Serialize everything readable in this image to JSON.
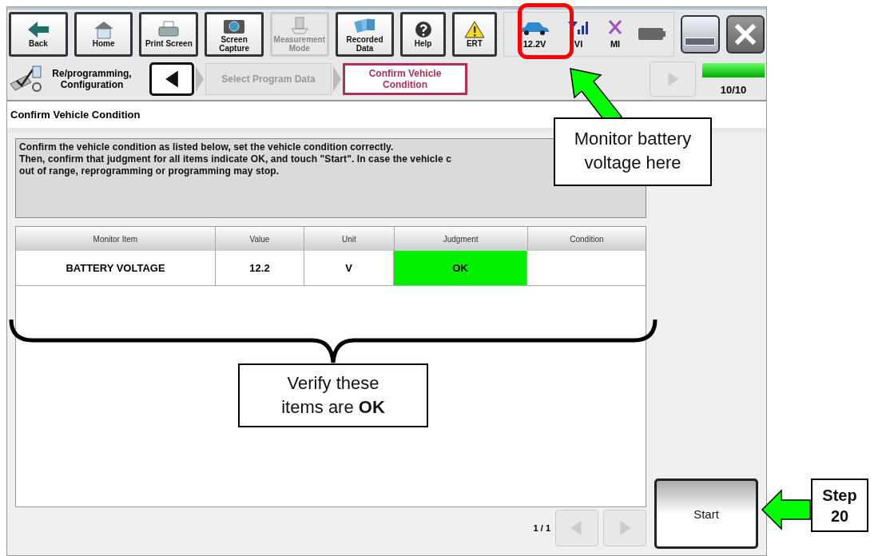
{
  "toolbar": {
    "buttons": [
      {
        "label": "Back",
        "kind": "back",
        "disabled": false
      },
      {
        "label": "Home",
        "kind": "home",
        "disabled": false
      },
      {
        "label": "Print Screen",
        "kind": "print",
        "disabled": false
      },
      {
        "label": "Screen Capture",
        "kind": "capture",
        "disabled": false
      },
      {
        "label": "Measurement Mode",
        "kind": "measurement",
        "disabled": true
      },
      {
        "label": "Recorded Data",
        "kind": "recorded",
        "disabled": false
      },
      {
        "label": "Help",
        "kind": "help",
        "disabled": false
      },
      {
        "label": "ERT",
        "kind": "ert",
        "disabled": false
      }
    ],
    "status": [
      {
        "label": "12.2V",
        "kind": "car"
      },
      {
        "label": "VI",
        "kind": "signal"
      },
      {
        "label": "MI",
        "kind": "cross"
      },
      {
        "kind": "battery"
      }
    ]
  },
  "breadcrumb": {
    "app_label": "Re/programming, Configuration",
    "steps": [
      {
        "label": "Select Program Data",
        "selected": false
      },
      {
        "label": "Confirm Vehicle Condition",
        "selected": true
      }
    ],
    "progress": {
      "level": 1,
      "label": "10/10"
    }
  },
  "section_title": "Confirm Vehicle Condition",
  "message_lines": [
    "Confirm the vehicle condition as listed below, set the vehicle condition correctly.",
    "Then, confirm that judgment for all items indicate OK, and touch \"Start\". In case the vehicle c",
    "out of range, reprogramming or programming may stop."
  ],
  "table": {
    "columns": [
      "Monitor Item",
      "Value",
      "Unit",
      "Judgment",
      "Condition"
    ],
    "rows": [
      {
        "cells": [
          "BATTERY VOLTAGE",
          "12.2",
          "V",
          "OK",
          ""
        ],
        "pass": true
      }
    ]
  },
  "pager": {
    "label": "1 / 1"
  },
  "start_button": "Start",
  "annotations": [
    {
      "kind": "callout",
      "text": "Monitor battery voltage here"
    },
    {
      "kind": "callout",
      "text": "Verify these items are **OK**"
    },
    {
      "kind": "step",
      "text": "Step 20"
    }
  ]
}
